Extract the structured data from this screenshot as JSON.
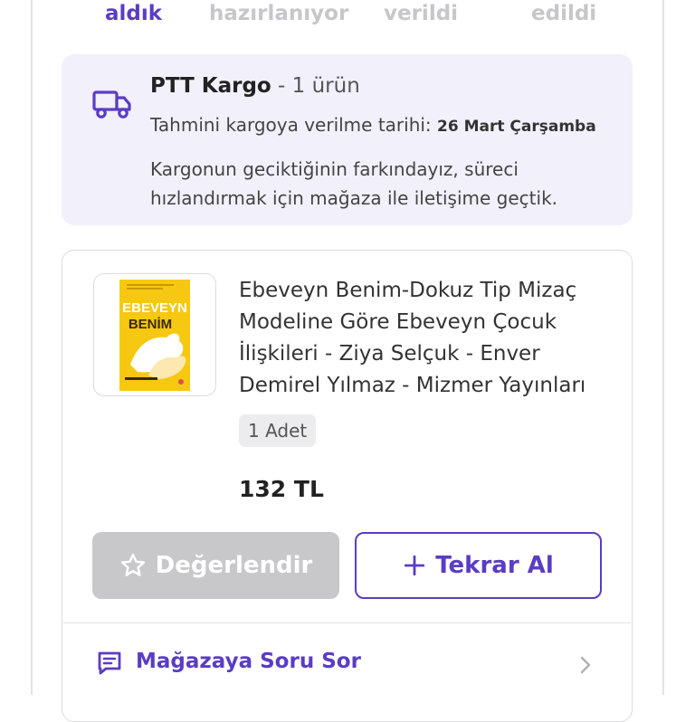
{
  "status_steps": [
    {
      "label": "aldık",
      "active": true
    },
    {
      "label": "hazırlanıyor",
      "active": false
    },
    {
      "label": "verildi",
      "active": false
    },
    {
      "label": "edildi",
      "active": false
    }
  ],
  "shipping": {
    "icon": "truck-icon",
    "carrier": "PTT Kargo",
    "count": " - 1 ürün",
    "eta_label": "Tahmini kargoya verilme tarihi: ",
    "eta_date": "26 Mart Çarşamba",
    "delay_message": "Kargonun geciktiğinin farkındayız, süreci hızlandırmak için mağaza ile iletişime geçtik."
  },
  "product": {
    "title": "Ebeveyn Benim-Dokuz Tip Mizaç Modeline Göre Ebeveyn Çocuk İlişkileri - Ziya Selçuk -  Enver Demirel Yılmaz - Mizmer Yayınları",
    "quantity": "1 Adet",
    "price": "132 TL",
    "cover_text": {
      "line1": "EBEVEYN",
      "line2": "BENİM"
    },
    "cover_color": "#f7c811"
  },
  "actions": {
    "rate_label": "Değerlendir",
    "rate_icon": "star-outline-icon",
    "reorder_label": "Tekrar Al",
    "reorder_icon": "plus-icon"
  },
  "store_question": {
    "label": "Mağazaya Soru Sor",
    "icon": "chat-message-icon"
  },
  "colors": {
    "accent": "#5b3cc4",
    "info_background": "#f2f0fb",
    "disabled_button": "#c8c8cb"
  }
}
